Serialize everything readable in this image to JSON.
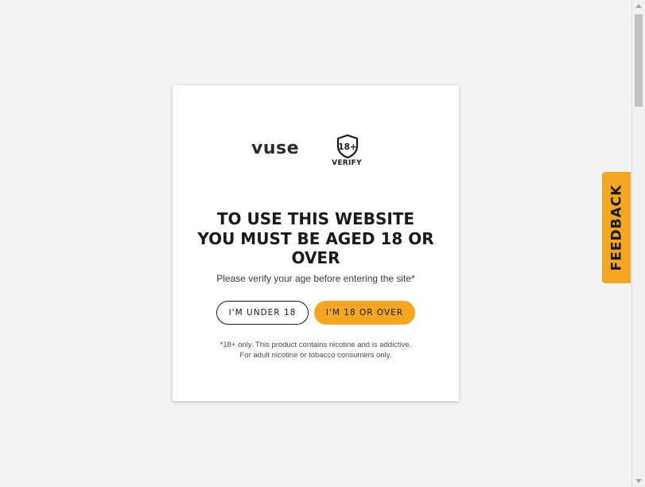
{
  "modal": {
    "brand": "vuse",
    "badge": {
      "number": "18+",
      "label": "VERIFY"
    },
    "headline": "TO USE THIS WEBSITE YOU MUST BE AGED 18 OR OVER",
    "subtext": "Please verify your age before entering the site*",
    "buttons": {
      "under": "I'M UNDER 18",
      "over": "I'M 18 OR OVER"
    },
    "disclaimer": {
      "line1": "*18+ only. This product contains nicotine and is addictive.",
      "line2": "For adult nicotine or tobacco consumers only."
    }
  },
  "feedback": {
    "label": "FEEDBACK"
  },
  "colors": {
    "accent": "#f5a623",
    "background": "#f2f3f3",
    "text": "#1a1a1a"
  }
}
